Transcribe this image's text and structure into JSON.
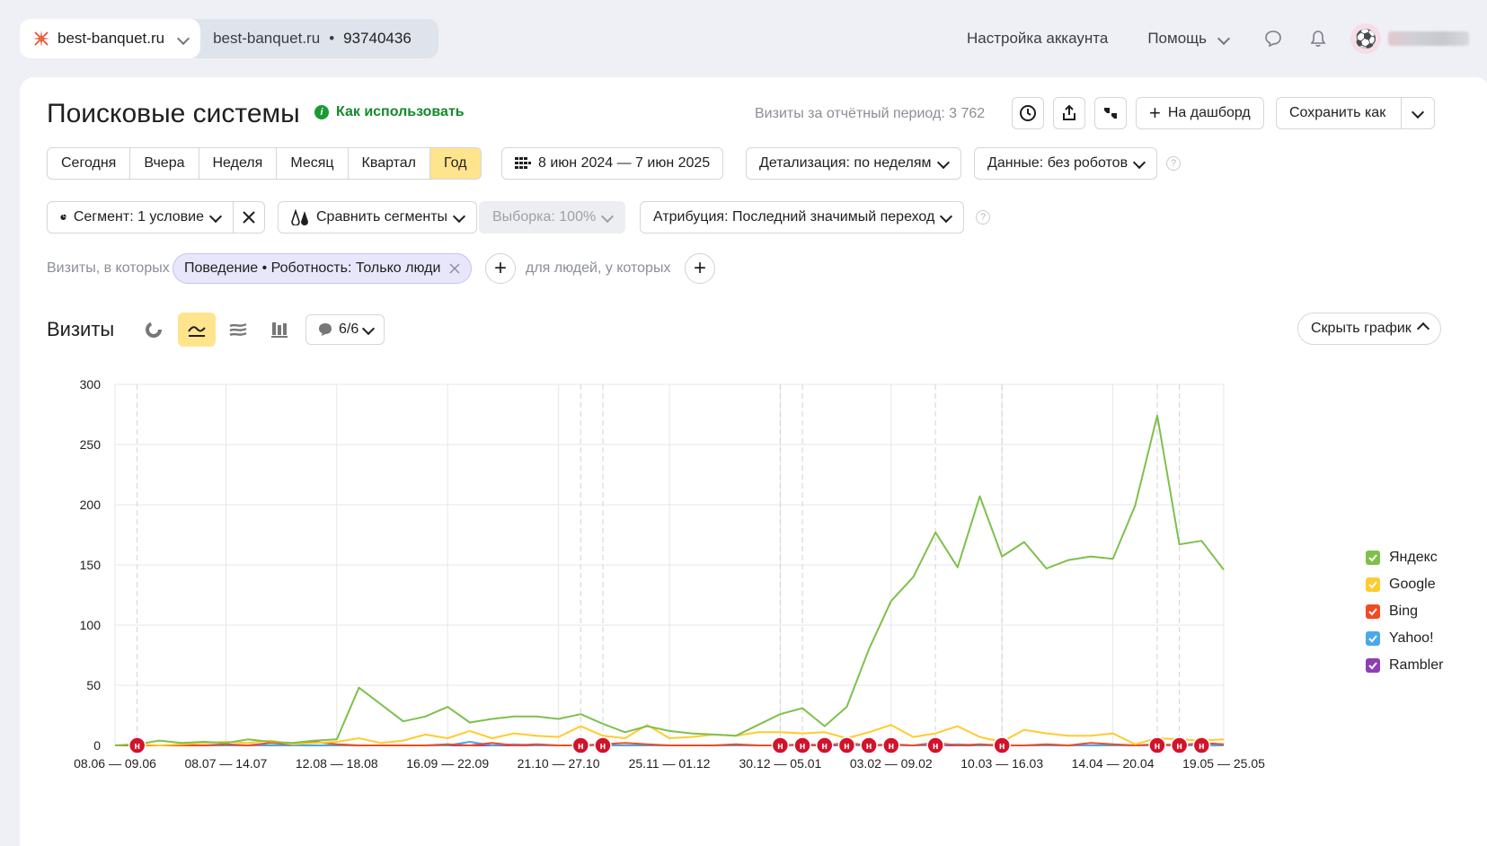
{
  "topbar": {
    "site_name": "best-banquet.ru",
    "site_sub": "best-banquet.ru",
    "counter_sep": "•",
    "counter_id": "93740436",
    "account_settings": "Настройка аккаунта",
    "help": "Помощь"
  },
  "header": {
    "title": "Поисковые системы",
    "how_to_use": "Как использовать",
    "visits_total": "Визиты за отчётный период: 3 762",
    "to_dashboard": "На дашборд",
    "save_as": "Сохранить как"
  },
  "periods": [
    {
      "label": "Сегодня",
      "active": false
    },
    {
      "label": "Вчера",
      "active": false
    },
    {
      "label": "Неделя",
      "active": false
    },
    {
      "label": "Месяц",
      "active": false
    },
    {
      "label": "Квартал",
      "active": false
    },
    {
      "label": "Год",
      "active": true
    }
  ],
  "date_range": "8 июн 2024 — 7 июн 2025",
  "detail": "Детализация: по неделям",
  "data_filter": "Данные: без роботов",
  "segment": "Сегмент: 1 условие",
  "compare": "Сравнить сегменты",
  "sample": "Выборка: 100%",
  "attribution": "Атрибуция: Последний значимый переход",
  "filters": {
    "prefix": "Визиты, в которых",
    "chip": "Поведение • Роботность: Только люди",
    "people": "для людей, у которых"
  },
  "chart_section": {
    "title": "Визиты",
    "series_count": "6/6",
    "hide_chart": "Скрыть график",
    "note_marker": "н"
  },
  "chart_data": {
    "type": "line",
    "title": "",
    "xlabel": "",
    "ylabel": "",
    "ylim": [
      0,
      300
    ],
    "yticks": [
      0,
      50,
      100,
      150,
      200,
      250,
      300
    ],
    "xtick_labels": [
      "08.06 — 09.06",
      "08.07 — 14.07",
      "12.08 — 18.08",
      "16.09 — 22.09",
      "21.10 — 27.10",
      "25.11 — 01.12",
      "30.12 — 05.01",
      "03.02 — 09.02",
      "10.03 — 16.03",
      "14.04 — 20.04",
      "19.05 — 25.05"
    ],
    "series": [
      {
        "name": "Яндекс",
        "color": "#7fc04c",
        "values": [
          0,
          1,
          4,
          2,
          3,
          2,
          5,
          3,
          2,
          4,
          5,
          48,
          34,
          20,
          24,
          32,
          19,
          22,
          24,
          24,
          22,
          26,
          18,
          11,
          16,
          12,
          10,
          9,
          8,
          17,
          26,
          31,
          16,
          32,
          80,
          120,
          140,
          177,
          148,
          207,
          157,
          169,
          147,
          154,
          157,
          155,
          199,
          274,
          167,
          170,
          146
        ]
      },
      {
        "name": "Google",
        "color": "#ffcb2f",
        "values": [
          0,
          1,
          0,
          1,
          2,
          3,
          2,
          4,
          1,
          2,
          3,
          6,
          2,
          4,
          9,
          6,
          12,
          6,
          10,
          8,
          7,
          16,
          8,
          6,
          17,
          6,
          7,
          9,
          8,
          11,
          11,
          10,
          11,
          6,
          11,
          17,
          7,
          10,
          16,
          7,
          3,
          13,
          10,
          8,
          8,
          10,
          1,
          6,
          5,
          4,
          5
        ]
      },
      {
        "name": "Bing",
        "color": "#f04b23",
        "values": [
          0,
          0,
          0,
          0,
          0,
          1,
          0,
          2,
          1,
          3,
          1,
          0,
          0,
          0,
          0,
          1,
          0,
          2,
          0,
          1,
          0,
          0,
          1,
          2,
          1,
          0,
          0,
          0,
          1,
          0,
          0,
          1,
          0,
          2,
          0,
          1,
          0,
          2,
          0,
          1,
          0,
          0,
          1,
          0,
          2,
          1,
          0,
          1,
          0,
          2,
          1
        ]
      },
      {
        "name": "Yahoo!",
        "color": "#4aa8ea",
        "values": [
          0,
          0,
          0,
          0,
          0,
          0,
          0,
          0,
          0,
          0,
          0,
          0,
          0,
          0,
          0,
          0,
          3,
          0,
          1,
          0,
          0,
          0,
          0,
          0,
          0,
          0,
          0,
          0,
          0,
          0,
          0,
          0,
          1,
          0,
          0,
          0,
          0,
          0,
          1,
          0,
          0,
          0,
          0,
          0,
          0,
          0,
          0,
          0,
          0,
          0,
          0
        ]
      },
      {
        "name": "Rambler",
        "color": "#8e3fb5",
        "values": [
          0,
          0,
          0,
          0,
          0,
          0,
          0,
          0,
          0,
          0,
          0,
          0,
          0,
          0,
          0,
          0,
          0,
          0,
          0,
          0,
          0,
          0,
          0,
          0,
          0,
          0,
          0,
          0,
          0,
          0,
          0,
          0,
          0,
          0,
          0,
          0,
          0,
          0,
          0,
          0,
          0,
          0,
          0,
          0,
          0,
          0,
          0,
          0,
          1,
          0,
          0
        ]
      }
    ],
    "notes_at_index": [
      1,
      21,
      22,
      30,
      31,
      32,
      33,
      34,
      35,
      37,
      40,
      47,
      48,
      49
    ],
    "dashed_lines_at_index": [
      1,
      21,
      22,
      30,
      31,
      37,
      40,
      47,
      48
    ],
    "grid": true,
    "legend": "right"
  }
}
